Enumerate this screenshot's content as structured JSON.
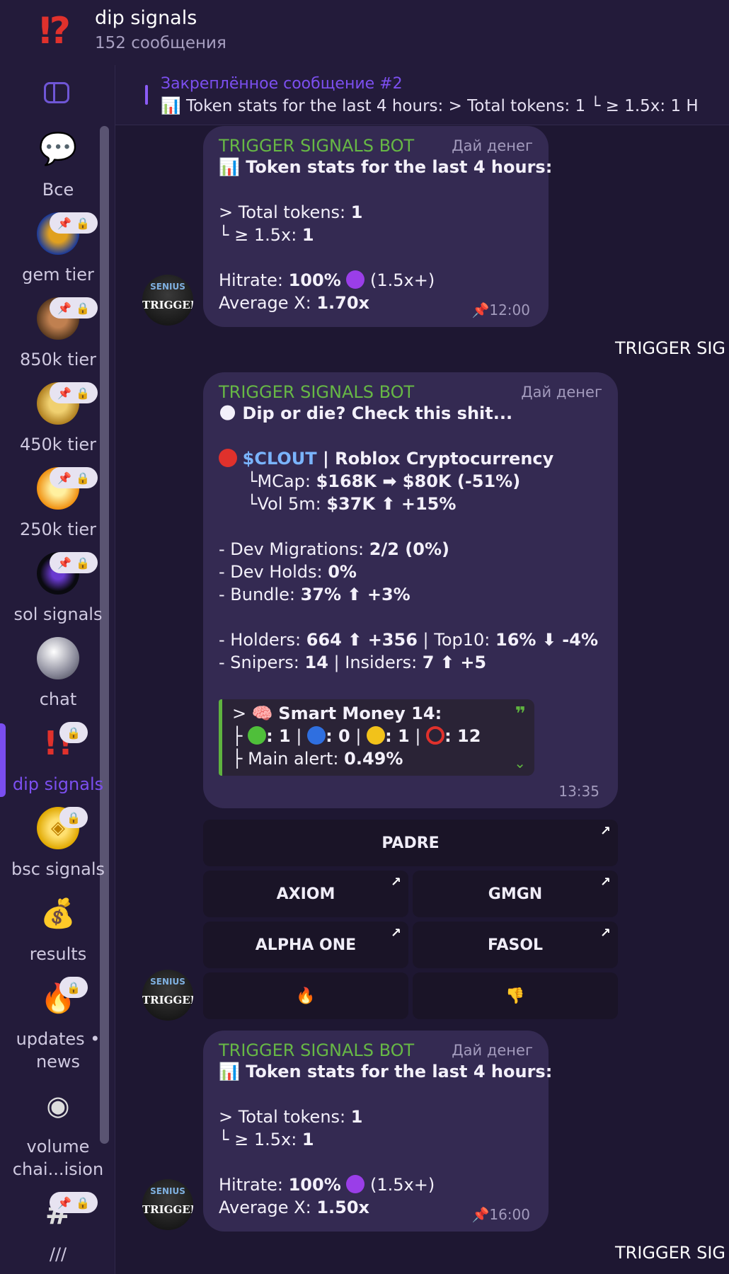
{
  "header": {
    "title": "dip signals",
    "subtitle": "152 сообщения"
  },
  "sidebar": {
    "folders": [
      {
        "label": "Все",
        "icon": "chat-bubbles-icon"
      },
      {
        "label": "gem tier",
        "icon": "avatar-icon"
      },
      {
        "label": "850k tier",
        "icon": "avatar-icon"
      },
      {
        "label": "450k tier",
        "icon": "avatar-icon"
      },
      {
        "label": "250k tier",
        "icon": "avatar-icon"
      },
      {
        "label": "sol signals",
        "icon": "avatar-icon"
      },
      {
        "label": "chat",
        "icon": "disco-ball-icon"
      },
      {
        "label": "dip signals",
        "icon": "exclamation-icon"
      },
      {
        "label": "bsc signals",
        "icon": "bnb-coin-icon"
      },
      {
        "label": "results",
        "icon": "money-bag-icon"
      },
      {
        "label": "updates • news",
        "icon": "fire-icon"
      },
      {
        "label": "volume chai...ision",
        "icon": "eye-icon"
      },
      {
        "label": "///",
        "icon": "hashtag-icon"
      }
    ]
  },
  "pinned": {
    "title": "Закреплённое сообщение #2",
    "text": "📊 Token stats for the last 4 hours:  > Total tokens: 1  └ ≥ 1.5x: 1  H"
  },
  "avatar": {
    "top": "SENIUS",
    "text": "TRIGGER"
  },
  "messages": {
    "stats1": {
      "sender": "TRIGGER SIGNALS BOT",
      "role": "Дай денег",
      "title": "📊 Token stats for the last 4 hours:",
      "total_label": "> Total tokens: ",
      "total_value": "1",
      "ratio_label": " └ ≥ 1.5x: ",
      "ratio_value": "1",
      "hitrate_label": "Hitrate: ",
      "hitrate_value": "100%",
      "hitrate_suffix": " (1.5x+)",
      "avgx_label": "Average X: ",
      "avgx_value": "1.70x",
      "time": "12:00"
    },
    "separator1": "TRIGGER SIG",
    "dip": {
      "sender": "TRIGGER SIGNALS BOT",
      "role": "Дай денег",
      "title": "Dip or die? Check this shit...",
      "token": "$CLOUT",
      "token_name": " | Roblox Cryptocurrency",
      "mcap_label": "└MCap: ",
      "mcap_value": "$168K ➡ $80K (-51%)",
      "vol_label": "└Vol 5m: ",
      "vol_value": "$37K ⬆ +15%",
      "dev_mig_label": "- Dev Migrations: ",
      "dev_mig_value": "2/2 (0%)",
      "dev_holds_label": "- Dev Holds: ",
      "dev_holds_value": "0%",
      "bundle_label": "- Bundle: ",
      "bundle_value": "37% ⬆ +3%",
      "holders_label": "- Holders: ",
      "holders_value": "664 ⬆ +356",
      "top10_label": " | Top10: ",
      "top10_value": "16% ⬇ -4%",
      "snipers_label": "- Snipers: ",
      "snipers_value": "14",
      "insiders_label": " | Insiders: ",
      "insiders_value": "7 ⬆ +5",
      "sm_title": "Smart Money 14:",
      "sm_green": "1",
      "sm_blue": "0",
      "sm_yellow": "1",
      "sm_red": "12",
      "main_alert_label": "├ Main alert: ",
      "main_alert_value": "0.49%",
      "time": "13:35"
    },
    "keyboard": {
      "padre": "PADRE",
      "axiom": "AXIOM",
      "gmgn": "GMGN",
      "alpha": "ALPHA ONE",
      "fasol": "FASOL",
      "fire": "🔥",
      "thumbs": "👎"
    },
    "stats2": {
      "sender": "TRIGGER SIGNALS BOT",
      "role": "Дай денег",
      "title": "📊 Token stats for the last 4 hours:",
      "total_label": "> Total tokens: ",
      "total_value": "1",
      "ratio_label": " └ ≥ 1.5x: ",
      "ratio_value": "1",
      "hitrate_label": "Hitrate: ",
      "hitrate_value": "100%",
      "hitrate_suffix": " (1.5x+)",
      "avgx_label": "Average X: ",
      "avgx_value": "1.50x",
      "time": "16:00"
    },
    "separator2": "TRIGGER SIG"
  }
}
